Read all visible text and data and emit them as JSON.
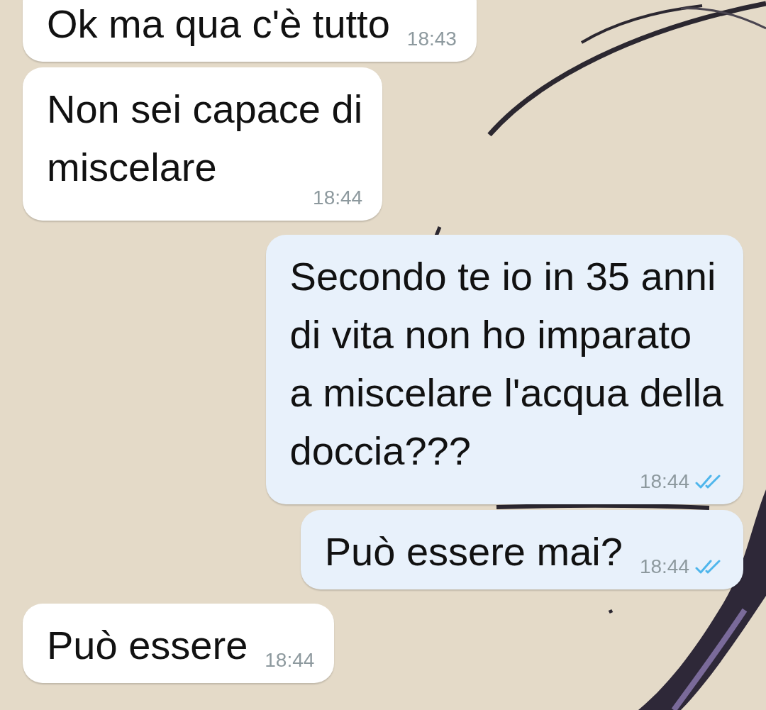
{
  "messages": [
    {
      "kind": "received",
      "lines": [
        "Ok ma qua c'è tutto"
      ],
      "time": "18:43"
    },
    {
      "kind": "received",
      "lines": [
        "Non sei capace di",
        "miscelare"
      ],
      "time": "18:44"
    },
    {
      "kind": "sent",
      "lines": [
        "Secondo te io in 35 anni",
        "di vita non ho imparato",
        "a miscelare l'acqua della",
        "doccia???"
      ],
      "time": "18:44",
      "read": true
    },
    {
      "kind": "sent",
      "lines": [
        "Può essere mai?"
      ],
      "time": "18:44",
      "read": true
    },
    {
      "kind": "received",
      "lines": [
        "Può essere"
      ],
      "time": "18:44"
    }
  ]
}
